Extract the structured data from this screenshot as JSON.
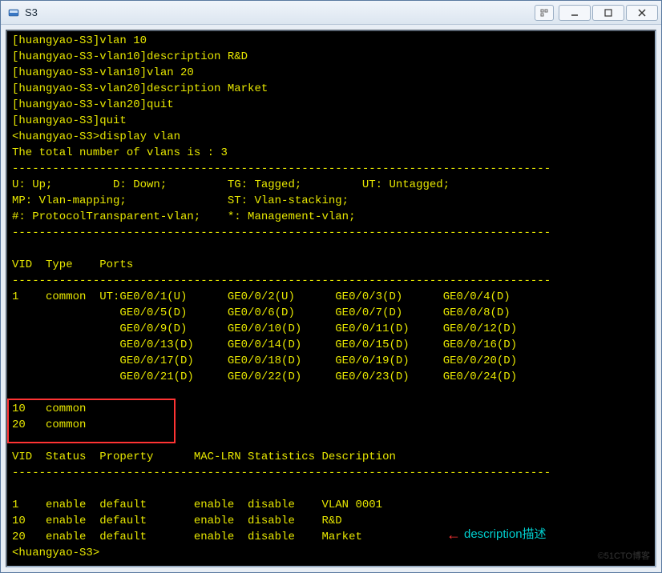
{
  "window": {
    "title": "S3"
  },
  "terminal": {
    "lines": [
      "[huangyao-S3]vlan 10",
      "[huangyao-S3-vlan10]description R&D",
      "[huangyao-S3-vlan10]vlan 20",
      "[huangyao-S3-vlan20]description Market",
      "[huangyao-S3-vlan20]quit",
      "[huangyao-S3]quit",
      "<huangyao-S3>display vlan",
      "The total number of vlans is : 3",
      "--------------------------------------------------------------------------------",
      "U: Up;         D: Down;         TG: Tagged;         UT: Untagged;",
      "MP: Vlan-mapping;               ST: Vlan-stacking;",
      "#: ProtocolTransparent-vlan;    *: Management-vlan;",
      "--------------------------------------------------------------------------------",
      "",
      "VID  Type    Ports",
      "--------------------------------------------------------------------------------",
      "1    common  UT:GE0/0/1(U)      GE0/0/2(U)      GE0/0/3(D)      GE0/0/4(D)",
      "                GE0/0/5(D)      GE0/0/6(D)      GE0/0/7(D)      GE0/0/8(D)",
      "                GE0/0/9(D)      GE0/0/10(D)     GE0/0/11(D)     GE0/0/12(D)",
      "                GE0/0/13(D)     GE0/0/14(D)     GE0/0/15(D)     GE0/0/16(D)",
      "                GE0/0/17(D)     GE0/0/18(D)     GE0/0/19(D)     GE0/0/20(D)",
      "                GE0/0/21(D)     GE0/0/22(D)     GE0/0/23(D)     GE0/0/24(D)",
      "",
      "10   common",
      "20   common",
      "",
      "VID  Status  Property      MAC-LRN Statistics Description",
      "--------------------------------------------------------------------------------",
      "",
      "1    enable  default       enable  disable    VLAN 0001",
      "10   enable  default       enable  disable    R&D",
      "20   enable  default       enable  disable    Market",
      "<huangyao-S3>"
    ]
  },
  "annotation": {
    "text": "description描述"
  },
  "watermark": "©51CTO博客",
  "vlan_data": {
    "total_vlans": 3,
    "legend": {
      "U": "Up",
      "D": "Down",
      "TG": "Tagged",
      "UT": "Untagged",
      "MP": "Vlan-mapping",
      "ST": "Vlan-stacking",
      "#": "ProtocolTransparent-vlan",
      "*": "Management-vlan"
    },
    "vlans": [
      {
        "vid": 1,
        "type": "common",
        "ports_ut": [
          "GE0/0/1(U)",
          "GE0/0/2(U)",
          "GE0/0/3(D)",
          "GE0/0/4(D)",
          "GE0/0/5(D)",
          "GE0/0/6(D)",
          "GE0/0/7(D)",
          "GE0/0/8(D)",
          "GE0/0/9(D)",
          "GE0/0/10(D)",
          "GE0/0/11(D)",
          "GE0/0/12(D)",
          "GE0/0/13(D)",
          "GE0/0/14(D)",
          "GE0/0/15(D)",
          "GE0/0/16(D)",
          "GE0/0/17(D)",
          "GE0/0/18(D)",
          "GE0/0/19(D)",
          "GE0/0/20(D)",
          "GE0/0/21(D)",
          "GE0/0/22(D)",
          "GE0/0/23(D)",
          "GE0/0/24(D)"
        ]
      },
      {
        "vid": 10,
        "type": "common"
      },
      {
        "vid": 20,
        "type": "common"
      }
    ],
    "vlan_status": [
      {
        "vid": 1,
        "status": "enable",
        "property": "default",
        "mac_lrn": "enable",
        "statistics": "disable",
        "description": "VLAN 0001"
      },
      {
        "vid": 10,
        "status": "enable",
        "property": "default",
        "mac_lrn": "enable",
        "statistics": "disable",
        "description": "R&D"
      },
      {
        "vid": 20,
        "status": "enable",
        "property": "default",
        "mac_lrn": "enable",
        "statistics": "disable",
        "description": "Market"
      }
    ]
  }
}
